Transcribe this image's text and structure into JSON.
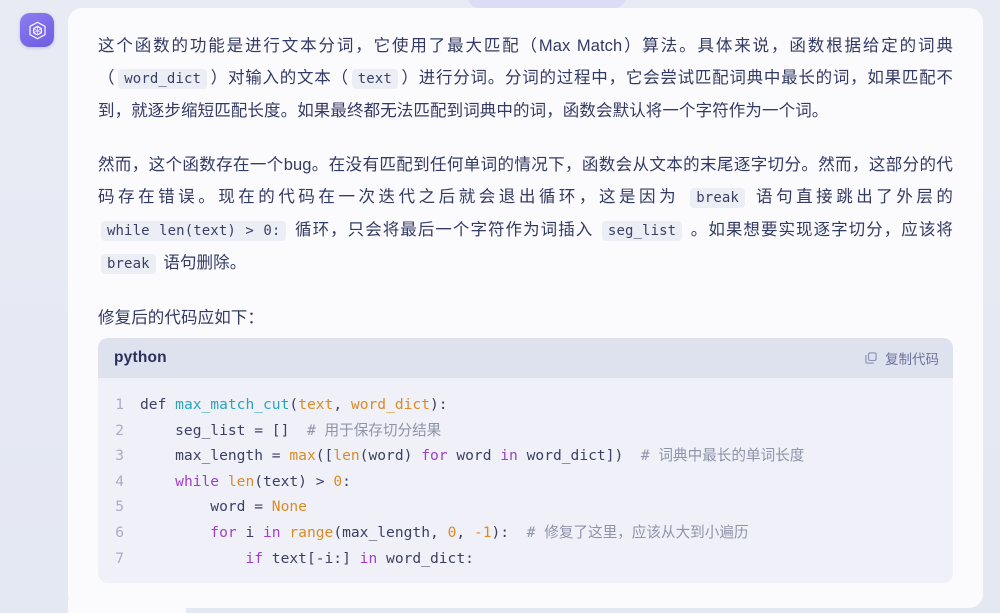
{
  "window": {
    "background_color": "#e7eaf4",
    "bubble_color": "#fbfbfd",
    "accent_color": "#7a6ae8"
  },
  "avatar": {
    "icon": "hexagon-cube-logo-icon"
  },
  "message": {
    "paragraphs": [
      {
        "id": "p1",
        "runs": [
          {
            "type": "text",
            "text": "这个函数的功能是进行文本分词，它使用了最大匹配（Max Match）算法。具体来说，函数根据给定的词典（"
          },
          {
            "type": "code",
            "text": "word_dict"
          },
          {
            "type": "text",
            "text": "）对输入的文本（"
          },
          {
            "type": "code",
            "text": "text"
          },
          {
            "type": "text",
            "text": "）进行分词。分词的过程中，它会尝试匹配词典中最长的词，如果匹配不到，就逐步缩短匹配长度。如果最终都无法匹配到词典中的词，函数会默认将一个字符作为一个词。"
          }
        ]
      },
      {
        "id": "p2",
        "runs": [
          {
            "type": "text",
            "text": "然而，这个函数存在一个bug。在没有匹配到任何单词的情况下，函数会从文本的末尾逐字切分。然而，这部分的代码存在错误。现在的代码在一次迭代之后就会退出循环，这是因为 "
          },
          {
            "type": "code",
            "text": "break"
          },
          {
            "type": "text",
            "text": " 语句直接跳出了外层的 "
          },
          {
            "type": "code",
            "text": "while len(text) > 0:"
          },
          {
            "type": "text",
            "text": " 循环，只会将最后一个字符作为词插入 "
          },
          {
            "type": "code",
            "text": "seg_list"
          },
          {
            "type": "text",
            "text": " 。如果想要实现逐字切分，应该将 "
          },
          {
            "type": "code",
            "text": "break"
          },
          {
            "type": "text",
            "text": " 语句删除。"
          }
        ]
      },
      {
        "id": "p3",
        "runs": [
          {
            "type": "text",
            "text": "修复后的代码应如下："
          }
        ]
      }
    ]
  },
  "code_block": {
    "language_label": "python",
    "copy_label": "复制代码",
    "copy_icon": "copy-icon",
    "lines": [
      {
        "number": "1",
        "tokens": [
          {
            "cls": "t-pl",
            "t": "def "
          },
          {
            "cls": "t-kw",
            "t": ""
          },
          {
            "cls": "t-fn",
            "t": "max_match_cut"
          },
          {
            "cls": "t-pl",
            "t": "("
          },
          {
            "cls": "t-par",
            "t": "text"
          },
          {
            "cls": "t-pl",
            "t": ", "
          },
          {
            "cls": "t-par",
            "t": "word_dict"
          },
          {
            "cls": "t-pl",
            "t": "):"
          }
        ]
      },
      {
        "number": "2",
        "tokens": [
          {
            "cls": "t-pl",
            "t": "    seg_list = []  "
          },
          {
            "cls": "t-cm",
            "t": "# 用于保存切分结果"
          }
        ]
      },
      {
        "number": "3",
        "tokens": [
          {
            "cls": "t-pl",
            "t": "    max_length = "
          },
          {
            "cls": "t-par",
            "t": "max"
          },
          {
            "cls": "t-pl",
            "t": "(["
          },
          {
            "cls": "t-par",
            "t": "len"
          },
          {
            "cls": "t-pl",
            "t": "(word) "
          },
          {
            "cls": "t-kw",
            "t": "for"
          },
          {
            "cls": "t-pl",
            "t": " word "
          },
          {
            "cls": "t-kw",
            "t": "in"
          },
          {
            "cls": "t-pl",
            "t": " word_dict])  "
          },
          {
            "cls": "t-cm",
            "t": "# 词典中最长的单词长度"
          }
        ]
      },
      {
        "number": "4",
        "tokens": [
          {
            "cls": "t-pl",
            "t": "    "
          },
          {
            "cls": "t-kw",
            "t": "while"
          },
          {
            "cls": "t-pl",
            "t": " "
          },
          {
            "cls": "t-par",
            "t": "len"
          },
          {
            "cls": "t-pl",
            "t": "(text) > "
          },
          {
            "cls": "t-num",
            "t": "0"
          },
          {
            "cls": "t-pl",
            "t": ":"
          }
        ]
      },
      {
        "number": "5",
        "tokens": [
          {
            "cls": "t-pl",
            "t": "        word = "
          },
          {
            "cls": "t-par",
            "t": "None"
          }
        ]
      },
      {
        "number": "6",
        "tokens": [
          {
            "cls": "t-pl",
            "t": "        "
          },
          {
            "cls": "t-kw",
            "t": "for"
          },
          {
            "cls": "t-pl",
            "t": " i "
          },
          {
            "cls": "t-kw",
            "t": "in"
          },
          {
            "cls": "t-pl",
            "t": " "
          },
          {
            "cls": "t-par",
            "t": "range"
          },
          {
            "cls": "t-pl",
            "t": "(max_length, "
          },
          {
            "cls": "t-num",
            "t": "0"
          },
          {
            "cls": "t-pl",
            "t": ", "
          },
          {
            "cls": "t-num",
            "t": "-1"
          },
          {
            "cls": "t-pl",
            "t": "):  "
          },
          {
            "cls": "t-cm",
            "t": "# 修复了这里，应该从大到小遍历"
          }
        ]
      },
      {
        "number": "7",
        "tokens": [
          {
            "cls": "t-pl",
            "t": "            "
          },
          {
            "cls": "t-kw",
            "t": "if"
          },
          {
            "cls": "t-pl",
            "t": " text[-i:] "
          },
          {
            "cls": "t-kw",
            "t": "in"
          },
          {
            "cls": "t-pl",
            "t": " word_dict:"
          }
        ]
      }
    ]
  }
}
